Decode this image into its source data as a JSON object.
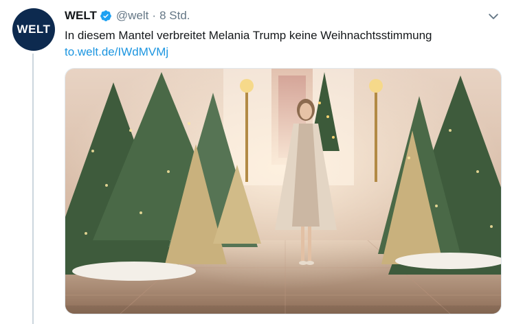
{
  "author": {
    "avatar_text": "WELT",
    "name": "WELT",
    "handle": "@welt",
    "separator": "·",
    "time": "8 Std."
  },
  "tweet": {
    "text": "In diesem Mantel verbreitet Melania Trump keine Weihnachtsstimmung",
    "link": "to.welt.de/IWdMVMj"
  },
  "icons": {
    "verified": "verified-badge-icon",
    "more": "chevron-down-icon"
  },
  "colors": {
    "link": "#1b95e0",
    "verified": "#1da1f2",
    "avatar_bg": "#0d2a4f",
    "secondary_text": "#657786"
  }
}
